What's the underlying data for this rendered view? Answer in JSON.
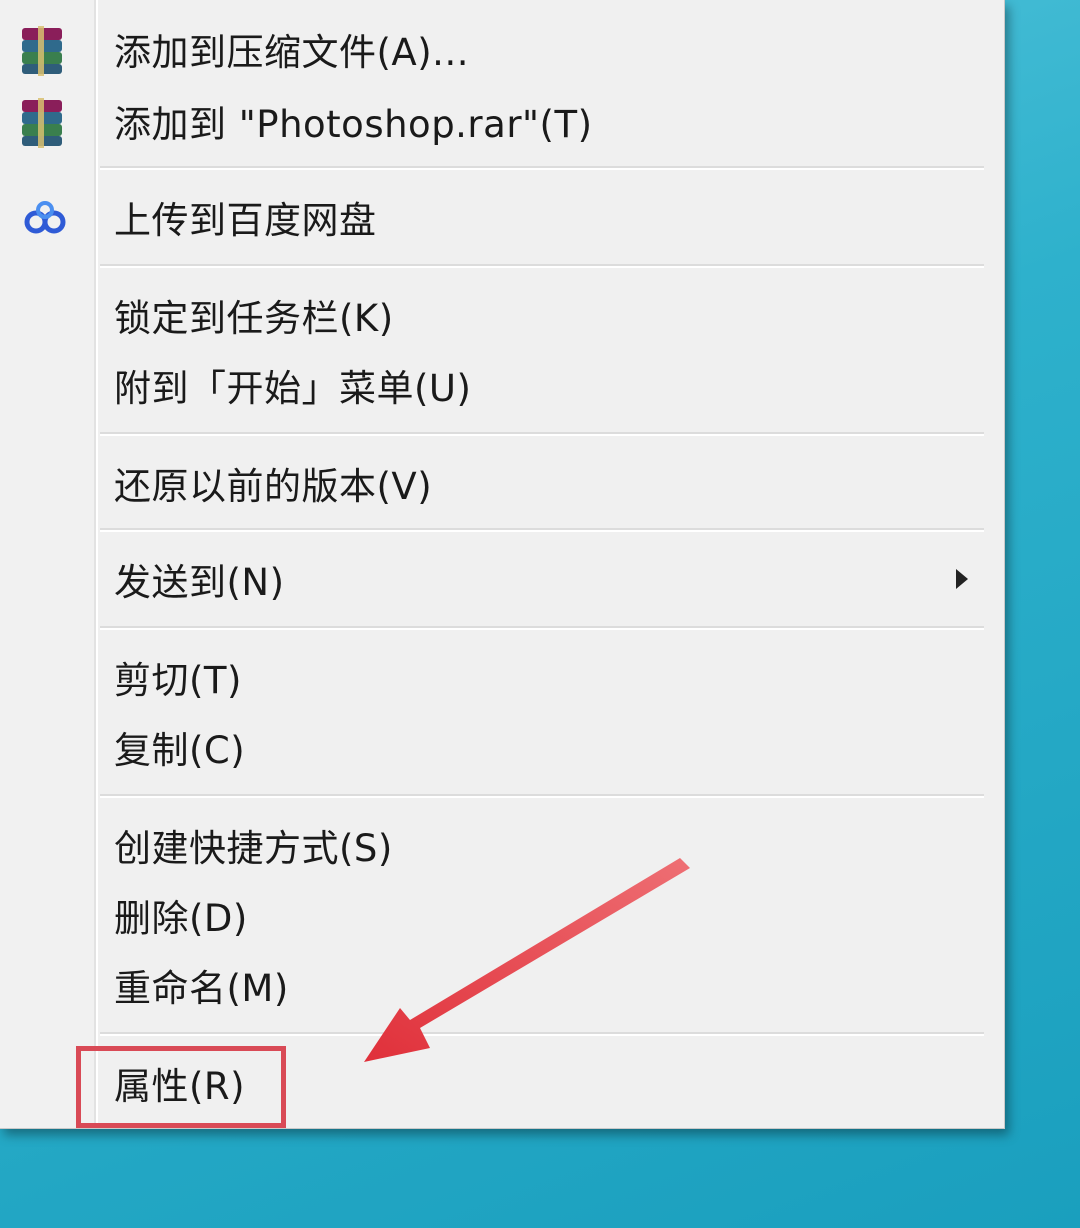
{
  "menu": {
    "items": [
      {
        "label": "添加到压缩文件(A)...",
        "icon": "winrar-archive-icon"
      },
      {
        "label": "添加到 \"Photoshop.rar\"(T)",
        "icon": "winrar-archive-icon"
      },
      {
        "label": "上传到百度网盘",
        "icon": "baidu-netdisk-icon"
      },
      {
        "label": "锁定到任务栏(K)"
      },
      {
        "label": "附到「开始」菜单(U)"
      },
      {
        "label": "还原以前的版本(V)"
      },
      {
        "label": "发送到(N)",
        "has_submenu": true
      },
      {
        "label": "剪切(T)"
      },
      {
        "label": "复制(C)"
      },
      {
        "label": "创建快捷方式(S)"
      },
      {
        "label": "删除(D)"
      },
      {
        "label": "重命名(M)"
      },
      {
        "label": "属性(R)",
        "highlighted": true
      }
    ]
  },
  "annotation": {
    "highlight_color": "#d94a56",
    "arrow_color": "#e0303a"
  },
  "colors": {
    "menu_background": "#f0f0f0",
    "desktop_background": "#2aa9c4"
  }
}
